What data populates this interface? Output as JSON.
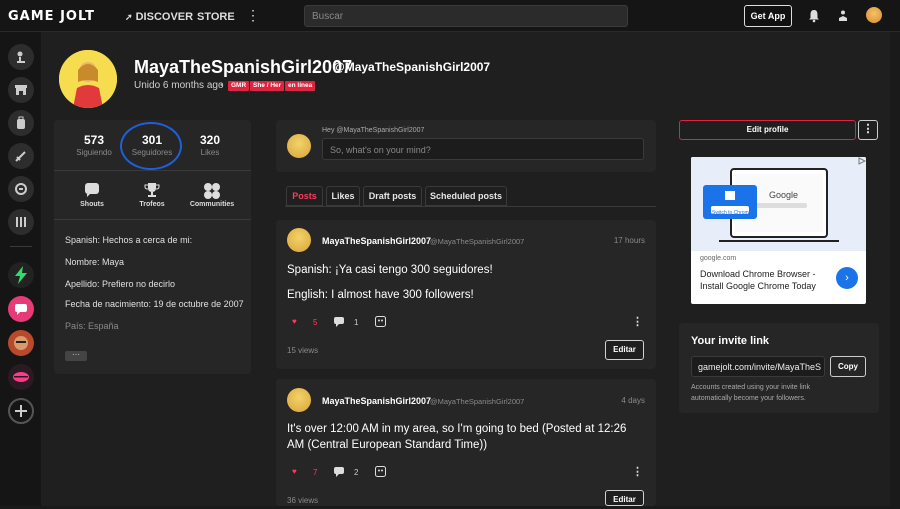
{
  "topbar": {
    "logo": "GAME JOLT",
    "nav_discover": "DISCOVER",
    "nav_store": "STORE",
    "more": "⋮",
    "search_placeholder": "Buscar",
    "get_app": "Get App"
  },
  "profile": {
    "name": "MayaTheSpanishGirl2007",
    "handle": "@MayaTheSpanishGirl2007",
    "joined": "Unido 6 months ago",
    "tags": [
      "GMR",
      "She / Her",
      "en línea"
    ]
  },
  "stats": [
    {
      "value": "573",
      "label": "Siguiendo"
    },
    {
      "value": "301",
      "label": "Seguidores"
    },
    {
      "value": "320",
      "label": "Likes"
    }
  ],
  "quick_links": [
    "Shouts",
    "Trofeos",
    "Communities"
  ],
  "bio": [
    "Spanish: Hechos a cerca de mi:",
    "Nombre: Maya",
    "Apellido: Prefiero no decirlo",
    "Fecha de nacimiento: 19 de octubre de 2007",
    "País: España"
  ],
  "bio_more": "···",
  "composer": {
    "hey": "Hey @MayaTheSpanishGirl2007",
    "placeholder": "So, what's on your mind?"
  },
  "tabs": [
    "Posts",
    "Likes",
    "Draft posts",
    "Scheduled posts"
  ],
  "posts": [
    {
      "author": "MayaTheSpanishGirl2007",
      "handle": "@MayaTheSpanishGirl2007",
      "time": "17 hours",
      "lines": [
        "Spanish: ¡Ya casi tengo 300 seguidores!",
        "English: I almost have 300 followers!"
      ],
      "likes": "5",
      "comments": "1",
      "views": "15 views",
      "edit": "Editar"
    },
    {
      "author": "MayaTheSpanishGirl2007",
      "handle": "@MayaTheSpanishGirl2007",
      "time": "4 days",
      "lines": [
        "It's over 12:00 AM in my area, so I'm going to bed (Posted at 12:26",
        "AM (Central European Standard Time))"
      ],
      "likes": "7",
      "comments": "2",
      "views": "36 views",
      "edit": "Editar"
    }
  ],
  "side": {
    "edit_profile": "Edit profile",
    "more": "⋮",
    "ad_domain": "google.com",
    "ad_title": "Download Chrome Browser - Install Google Chrome Today",
    "ad_brand": "Google",
    "ad_button": "Switch to Chrome",
    "invite_title": "Your invite link",
    "invite_link": "gamejolt.com/invite/MayaTheS",
    "copy": "Copy",
    "invite_desc": "Accounts created using your invite link automatically become your followers."
  },
  "colors": {
    "accent": "#ff3a5c",
    "tag_bg": "#e0243f",
    "highlight_circle": "#1f5fd8"
  }
}
